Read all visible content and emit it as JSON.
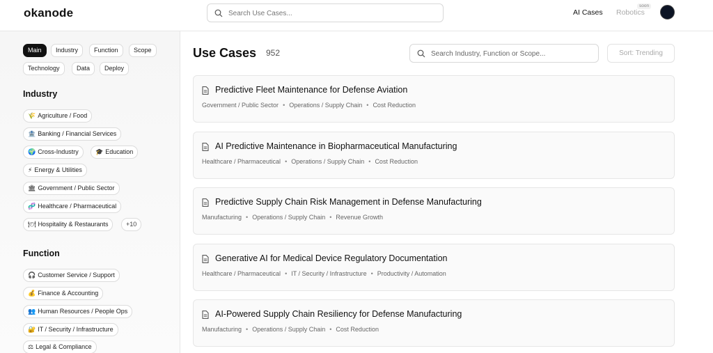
{
  "header": {
    "logo": "okanode",
    "search_placeholder": "Search Use Cases...",
    "nav_ai_cases": "AI Cases",
    "nav_robotics": "Robotics",
    "soon_tag": "soon"
  },
  "filters": {
    "tabs": [
      "Main",
      "Industry",
      "Function",
      "Scope",
      "Technology",
      "Data",
      "Deploy"
    ],
    "active_tab": "Main"
  },
  "industry": {
    "title": "Industry",
    "items": [
      {
        "emoji": "🌾",
        "label": "Agriculture / Food"
      },
      {
        "emoji": "🏦",
        "label": "Banking / Financial Services"
      },
      {
        "emoji": "🌍",
        "label": "Cross-Industry"
      },
      {
        "emoji": "🎓",
        "label": "Education"
      },
      {
        "emoji": "⚡",
        "label": "Energy & Utilities"
      },
      {
        "emoji": "🏛",
        "label": "Government / Public Sector"
      },
      {
        "emoji": "🧬",
        "label": "Healthcare / Pharmaceutical"
      },
      {
        "emoji": "🍽",
        "label": "Hospitality & Restaurants"
      }
    ],
    "more": "+10"
  },
  "function": {
    "title": "Function",
    "items": [
      {
        "emoji": "🎧",
        "label": "Customer Service / Support"
      },
      {
        "emoji": "💰",
        "label": "Finance & Accounting"
      },
      {
        "emoji": "👥",
        "label": "Human Resources / People Ops"
      },
      {
        "emoji": "🔐",
        "label": "IT / Security / Infrastructure"
      },
      {
        "emoji": "⚖",
        "label": "Legal & Compliance"
      }
    ]
  },
  "main": {
    "title": "Use Cases",
    "count": "952",
    "search_placeholder": "Search Industry, Function or Scope...",
    "sort_label": "Sort: Trending",
    "cards": [
      {
        "title": "Predictive Fleet Maintenance for Defense Aviation",
        "tags": [
          "Government / Public Sector",
          "Operations / Supply Chain",
          "Cost Reduction"
        ]
      },
      {
        "title": "AI Predictive Maintenance in Biopharmaceutical Manufacturing",
        "tags": [
          "Healthcare / Pharmaceutical",
          "Operations / Supply Chain",
          "Cost Reduction"
        ]
      },
      {
        "title": "Predictive Supply Chain Risk Management in Defense Manufacturing",
        "tags": [
          "Manufacturing",
          "Operations / Supply Chain",
          "Revenue Growth"
        ]
      },
      {
        "title": "Generative AI for Medical Device Regulatory Documentation",
        "tags": [
          "Healthcare / Pharmaceutical",
          "IT / Security / Infrastructure",
          "Productivity / Automation"
        ]
      },
      {
        "title": "AI-Powered Supply Chain Resiliency for Defense Manufacturing",
        "tags": [
          "Manufacturing",
          "Operations / Supply Chain",
          "Cost Reduction"
        ]
      }
    ]
  }
}
